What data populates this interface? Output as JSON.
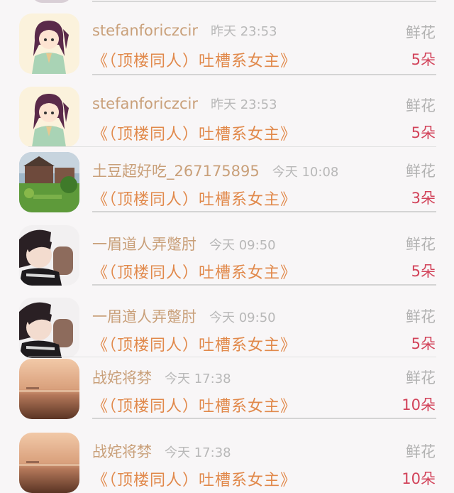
{
  "gift_label": "鲜花",
  "entries": [
    {
      "user": "stefanforiczcir",
      "time": "昨天 23:53",
      "title": "《（顶楼同人）吐槽系女主》",
      "count": "5朵",
      "avatar": "anime-girl-avatar"
    },
    {
      "user": "stefanforiczcir",
      "time": "昨天 23:53",
      "title": "《（顶楼同人）吐槽系女主》",
      "count": "5朵",
      "avatar": "anime-girl-avatar"
    },
    {
      "user": "土豆超好吃_267175895",
      "time": "今天 10:08",
      "title": "《（顶楼同人）吐槽系女主》",
      "count": "3朵",
      "avatar": "landscape-house-avatar"
    },
    {
      "user": "一眉道人弄蹩肘",
      "time": "今天 09:50",
      "title": "《（顶楼同人）吐槽系女主》",
      "count": "5朵",
      "avatar": "person-photo-avatar"
    },
    {
      "user": "一眉道人弄蹩肘",
      "time": "今天 09:50",
      "title": "《（顶楼同人）吐槽系女主》",
      "count": "5朵",
      "avatar": "person-photo-avatar"
    },
    {
      "user": "战姹将棼",
      "time": "今天 17:38",
      "title": "《（顶楼同人）吐槽系女主》",
      "count": "10朵",
      "avatar": "sunset-avatar"
    },
    {
      "user": "战姹将棼",
      "time": "今天 17:38",
      "title": "《（顶楼同人）吐槽系女主》",
      "count": "10朵",
      "avatar": "sunset-avatar"
    }
  ]
}
